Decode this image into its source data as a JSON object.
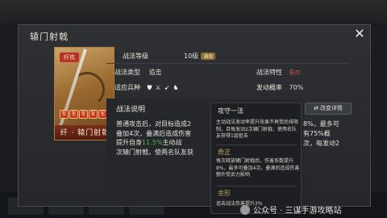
{
  "dialog": {
    "title": "辕门射戟",
    "close_icon": "close-icon"
  },
  "card": {
    "seal": "纤攻",
    "stars": [
      "军",
      "军",
      "军",
      "军",
      "军"
    ],
    "name": "纤 · 辕门射戟"
  },
  "info": {
    "level_label": "战法等级",
    "level_value": "10级",
    "level_badge": "满级",
    "type_label": "战法类型",
    "type_value": "追击",
    "trait_label": "战法特性",
    "trait_value": "奇刃",
    "troops_label": "适应兵种",
    "troops_icons": [
      "shield-icon",
      "sword-icon",
      "bow-icon",
      "horse-icon"
    ],
    "rate_label": "发动概率",
    "rate_value": "70%"
  },
  "desc": {
    "title": "战法说明",
    "line1": "普通攻击后，对目标造成2",
    "line2": "叠加4次，叠满后造成伤害",
    "line3_pre": "提升自身",
    "line3_hl": "11.5%",
    "line3_post": "主动战",
    "line4": "次辕门射戟，使两名队友获",
    "detail_button": "改变详情",
    "right1": "8%，最多可",
    "right2": "有75%概",
    "right3": "次，每发动2"
  },
  "popup": {
    "h1": "攻守一法",
    "t1": "主动战法发动率提升效果不再受后排限制，且每发动2次辕门射戟，使两名队友获得1层狙击",
    "h2": "奇正",
    "t2": "每次释放辕门射戟后，伤害系数提升8%，最多可叠加4次，叠满后造成伤害额外受武力影响",
    "h3": "余形",
    "t3": "追击战法伤害提升3%"
  },
  "watermark": {
    "text": "公众号 · 三谋手游攻略站"
  }
}
